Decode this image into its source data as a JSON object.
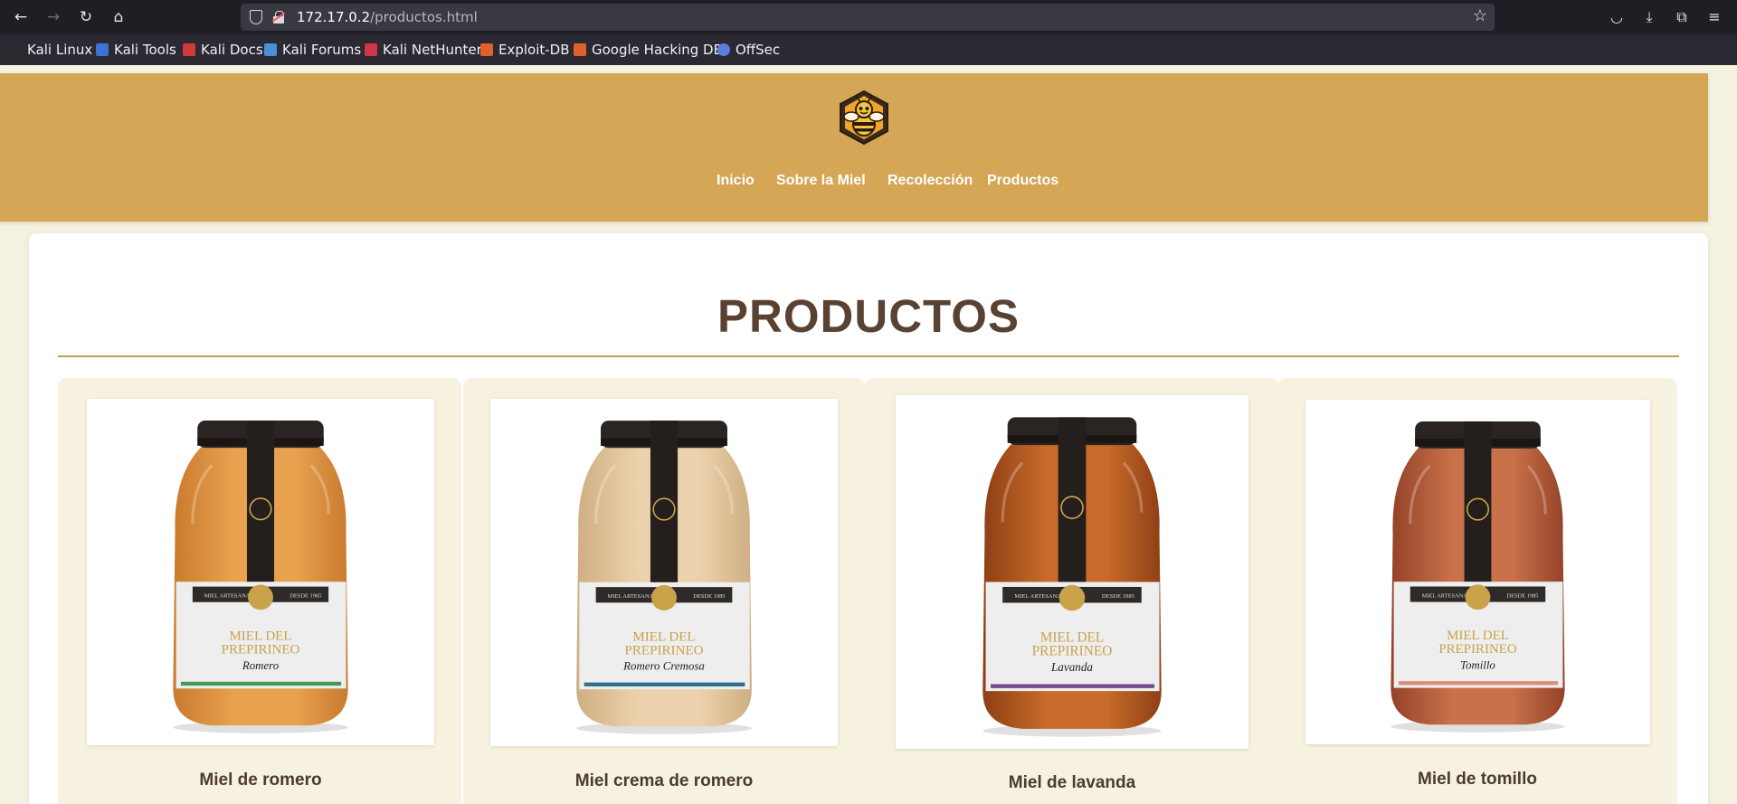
{
  "browser": {
    "url_host": "172.17.0.2",
    "url_path": "/productos.html",
    "bookmarks": [
      {
        "label": "Kali Linux",
        "color": "#2b2b2b"
      },
      {
        "label": "Kali Tools",
        "color": "#3f6fd8"
      },
      {
        "label": "Kali Docs",
        "color": "#d23a3a"
      },
      {
        "label": "Kali Forums",
        "color": "#4a8fd8"
      },
      {
        "label": "Kali NetHunter",
        "color": "#d2344a"
      },
      {
        "label": "Exploit-DB",
        "color": "#e0612a"
      },
      {
        "label": "Google Hacking DB",
        "color": "#e0612a"
      },
      {
        "label": "OffSec",
        "color": "#5b7de0"
      }
    ]
  },
  "site": {
    "nav": [
      {
        "label": "Inicio"
      },
      {
        "label": "Sobre la Miel"
      },
      {
        "label": "Recolección"
      },
      {
        "label": "Productos"
      }
    ],
    "page_title": "PRODUCTOS"
  },
  "products": [
    {
      "name": "Miel de romero",
      "honey_color": "#e8a24f",
      "honey_dark": "#c97a2e",
      "label_line": "Romero",
      "stripe": "#3f9a5a"
    },
    {
      "name": "Miel crema de romero",
      "honey_color": "#ecd2ac",
      "honey_dark": "#cfae82",
      "label_line": "Romero Cremosa",
      "stripe": "#2f6f8f"
    },
    {
      "name": "Miel de lavanda",
      "honey_color": "#c76a2a",
      "honey_dark": "#8e3f14",
      "label_line": "Lavanda",
      "stripe": "#7a4a8a"
    },
    {
      "name": "Miel de tomillo",
      "honey_color": "#c8714a",
      "honey_dark": "#944228",
      "label_line": "Tomillo",
      "stripe": "#e08a7a"
    }
  ],
  "jar_label": {
    "left_tag": "MIEL ARTESANA",
    "right_tag": "DESDE 1985",
    "brand_line1": "MIEL DEL",
    "brand_line2": "PREPIRINEO"
  },
  "colors": {
    "header_bg": "#d4a655",
    "page_bg": "#f6f2e1",
    "title_color": "#5a4233",
    "accent_rule": "#c79d4f"
  }
}
